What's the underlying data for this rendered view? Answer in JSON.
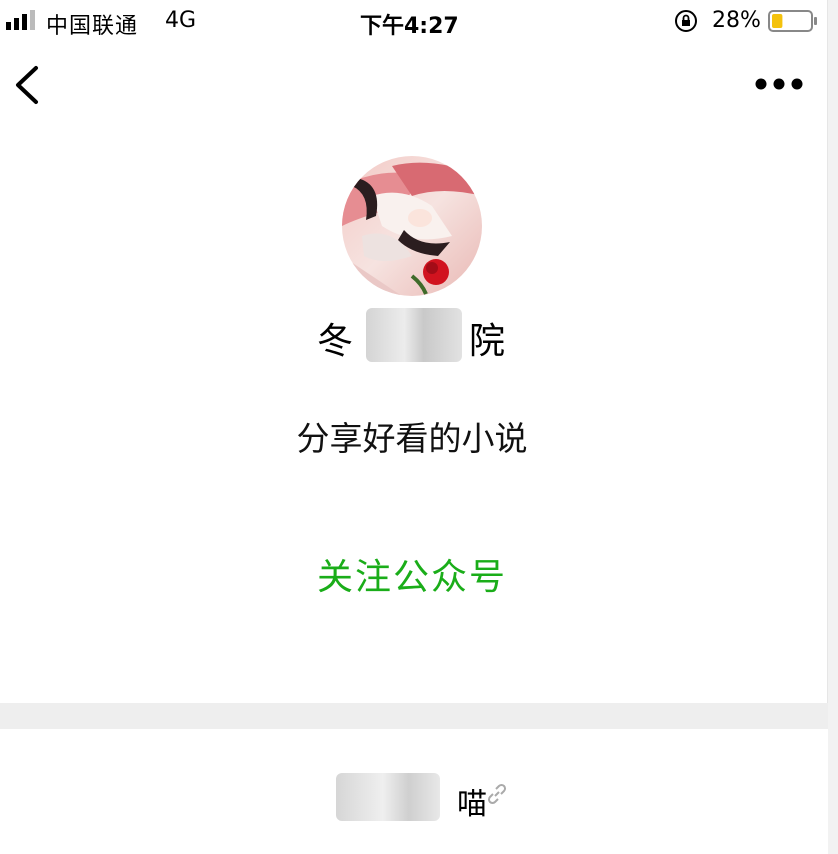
{
  "status_bar": {
    "carrier": "中国联通",
    "network": "4G",
    "time": "下午4:27",
    "battery_percent": "28%",
    "battery_level": 0.28,
    "icons": {
      "signal": "signal-bars-icon",
      "lock": "rotation-lock-icon",
      "battery": "battery-icon"
    },
    "colors": {
      "battery_fill": "#f4c20d"
    }
  },
  "nav_bar": {
    "icons": {
      "back": "chevron-left-icon",
      "more": "more-dots-icon"
    }
  },
  "profile": {
    "name": "冬　　　院",
    "description": "分享好看的小说",
    "follow_label": "关注公众号",
    "colors": {
      "follow": "#1aad19"
    }
  },
  "mini_program": {
    "name": "　　　　喵",
    "icon": "link-icon"
  }
}
